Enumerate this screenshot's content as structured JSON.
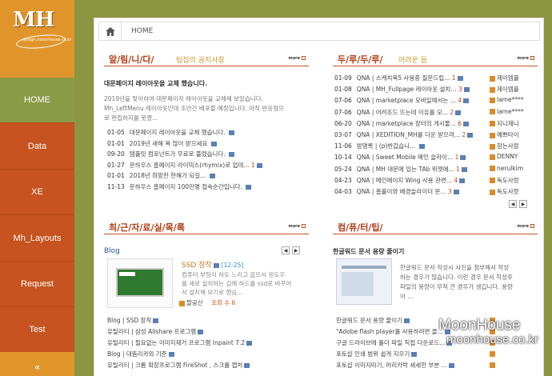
{
  "sidebar": {
    "logo_text": "MH",
    "logo_sub": "design.moonhouse.co.kr",
    "items": [
      "HOME",
      "Data",
      "XE",
      "Mh_Layouts",
      "Request",
      "Test"
    ],
    "bottom": "«"
  },
  "breadcrumb": {
    "label": "HOME"
  },
  "notice": {
    "title": "알/림/니/다/",
    "subtitle": "팀집의 공지사항",
    "more": "more",
    "headline": "대문페이지 레이아웃을 교체 했습니다.",
    "body": [
      "2019년을 맞이하여 대문페이지 레이아웃을 교체해 보았습니다.",
      "Mh_LeftMenu 레이아웃인데 조만간 배포할 예정입니다. 아직 반응형으",
      "로 편집하지를 못했..."
    ],
    "items": [
      {
        "date": "01-05",
        "title": "대문페이지 레이아웃을 교체 했습니다.",
        "count": ""
      },
      {
        "date": "01-01",
        "title": "2019년 새해 복 많이 받으세요",
        "count": ""
      },
      {
        "date": "09-20",
        "title": "템플릿 컴포넌트가 무료로 풀렸습니다.",
        "count": ""
      },
      {
        "date": "01-27",
        "title": "문하우스 홈페이지 라이믹스(rhymix)로 업데...",
        "count": "1"
      },
      {
        "date": "01-01",
        "title": "2018년 희망찬 한해가 되길...",
        "count": ""
      },
      {
        "date": "11-13",
        "title": "문하우스 홈페이지 100만명 접속순간입니다.",
        "count": ""
      }
    ]
  },
  "qna": {
    "title": "두/루/두/루/",
    "subtitle": "어려운 듬",
    "more": "more",
    "items": [
      {
        "date": "01-09",
        "cat": "QNA",
        "title": "스케치북5 사용중 질문드립...",
        "count": "1",
        "author": "제이엠플"
      },
      {
        "date": "01-08",
        "cat": "QNA",
        "title": "MH_Fullpage 레이아웃 설치...",
        "count": "3",
        "author": "제이엠플"
      },
      {
        "date": "07-06",
        "cat": "QNA",
        "title": "marketplace 모바일에서는 ...",
        "count": "4",
        "author": "lame****"
      },
      {
        "date": "07-06",
        "cat": "QNA",
        "title": "어려조드 뜨는데 이유를 모...",
        "count": "2",
        "author": "lame****"
      },
      {
        "date": "06-20",
        "cat": "QNA",
        "title": "marketplace 장터의 게시물...",
        "count": "6",
        "author": "지니제니"
      },
      {
        "date": "03-07",
        "cat": "QNA",
        "title": "XEDITION_MH를 다운 받으려...",
        "count": "2",
        "author": "예쁘타이"
      },
      {
        "date": "11-06",
        "cat": "방명록",
        "title": "(p)반갑습니...",
        "count": "",
        "author": "참는사람"
      },
      {
        "date": "10-14",
        "cat": "QNA",
        "title": "Sweet Mobile 메인 슬라이...",
        "count": "1",
        "author": "DENNY"
      },
      {
        "date": "05-24",
        "cat": "QNA",
        "title": "MH 대문에 있는 TAb 위젯에...",
        "count": "1",
        "author": "nerulkim"
      },
      {
        "date": "04-23",
        "cat": "QNA",
        "title": "메인페이지 Wing 사용 관련...",
        "count": "4",
        "author": "독도사랑"
      },
      {
        "date": "04-03",
        "cat": "QNA",
        "title": "홈플이와 배경슬라이더 문...",
        "count": "3",
        "author": "독도사랑"
      }
    ]
  },
  "recent": {
    "title": "최/근/자/료/실/목/록",
    "more": "more",
    "tab": "Blog",
    "item_title": "SSD 장착",
    "item_date": "[12-25]",
    "item_desc": [
      "컴퓨터 부팅이 하도 느리고 꼽뜨서 윈도우",
      "를 새로 설치하는 김에 하드를 ssd로 바꾸어",
      "서 설치해 보기로 했슴..."
    ],
    "item_author": "팔공산",
    "item_views": "조회 수 6",
    "items": [
      "Blog | SSD 장착",
      "유틸리티 | 삼성 Allshare 프로그램",
      "유틸리티 | 필요없는 이미지제거 프로그램 Inpaint 7.2",
      "Blog | 대뜸리카외 기준",
      "유틸리티 | 크롬 확장프로그램 FireShot , 스크롤 캡처"
    ]
  },
  "computer": {
    "title": "컴/퓨/터/팁/",
    "more": "more",
    "headline": "한글워드 문서 용량 줄이기",
    "body": [
      "한글워드 문서 작성시 사진을 첨부해서 작성",
      "하는 경우가 많습니다. 이런 경우 문서 작성후",
      "파일의 용량이 무척 큰 경우가 생깁니다. 용량",
      "이 ..."
    ],
    "items": [
      "한글워드 문서 용량 줄이기",
      "\"Adobe flash player를 사용하려면 클...",
      "구글 드라이브에 폴더 파일 직접 다운로드...",
      "포토샵 인쇄 범위 쉽게 지우기",
      "포토샵 이미지따기, 머리카락 세세한 부분 ..."
    ]
  },
  "watermark": {
    "line1": "MoonHouse",
    "line2": "moonhouse.co.kr"
  },
  "colors": {
    "sidebar": "#c65320",
    "logo_bg": "#e0952c",
    "active": "#8a9a45",
    "page_bg": "#8c9540"
  }
}
